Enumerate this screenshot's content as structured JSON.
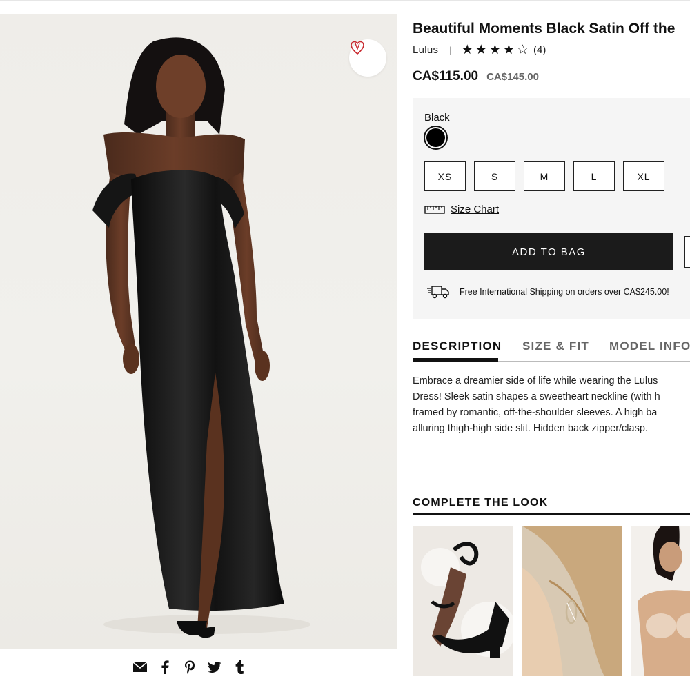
{
  "product": {
    "title": "Beautiful Moments Black Satin Off the",
    "brand": "Lulus",
    "brand_separator": "|",
    "rating_stars_filled": 4,
    "rating_stars_total": 5,
    "star_filled_glyph": "★",
    "star_empty_glyph": "☆",
    "review_count": "(4)",
    "price": "CA$115.00",
    "original_price": "CA$145.00"
  },
  "options": {
    "color_label": "Black",
    "color_swatch": "#000000",
    "sizes": [
      "XS",
      "S",
      "M",
      "L",
      "XL"
    ],
    "size_chart_label": "Size Chart"
  },
  "cta": {
    "add_to_bag": "ADD TO BAG"
  },
  "shipping": {
    "text": "Free International Shipping on orders over CA$245.00!"
  },
  "tabs": [
    {
      "label": "DESCRIPTION",
      "active": true
    },
    {
      "label": "SIZE & FIT",
      "active": false
    },
    {
      "label": "MODEL INFO",
      "active": false
    }
  ],
  "description_lines": [
    "Embrace a dreamier side of life while wearing the Lulus",
    "Dress! Sleek satin shapes a sweetheart neckline (with h",
    "framed by romantic, off-the-shoulder sleeves. A high ba",
    "alluring thigh-high side slit. Hidden back zipper/clasp."
  ],
  "complete_the_look": {
    "heading": "COMPLETE THE LOOK"
  },
  "icons": {
    "favorite": "heart-icon",
    "share": [
      "email-icon",
      "facebook-icon",
      "pinterest-icon",
      "twitter-icon",
      "tumblr-icon"
    ],
    "size_chart": "ruler-icon",
    "shipping": "truck-icon"
  },
  "colors": {
    "cta_background": "#1b1b1b",
    "heart": "#c8282e",
    "panel_background": "#f5f5f5"
  }
}
